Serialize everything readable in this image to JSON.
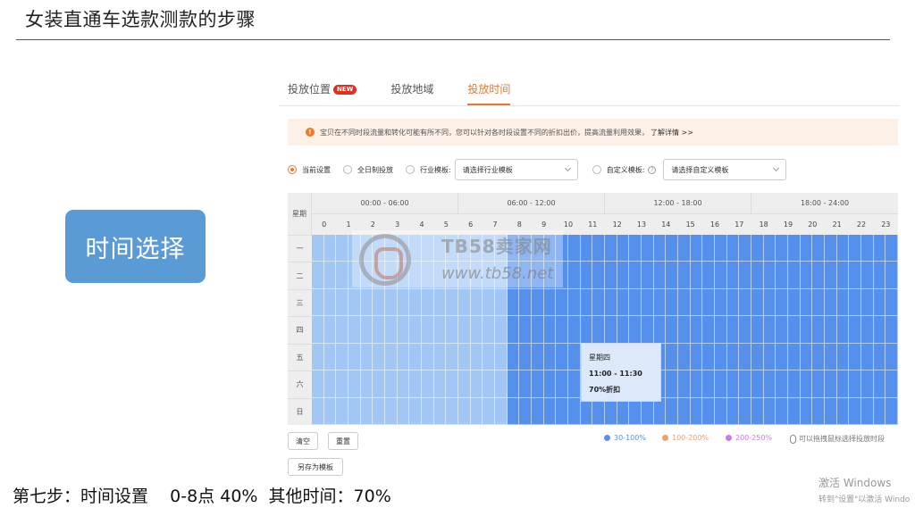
{
  "slide": {
    "title": "女装直通车选款测款的步骤",
    "step_box": "时间选择",
    "footer": "第七步：时间设置    0-8点 40%  其他时间：70%"
  },
  "tabs": [
    {
      "label": "投放位置",
      "badge": "NEW",
      "active": false
    },
    {
      "label": "投放地域",
      "active": false
    },
    {
      "label": "投放时间",
      "active": true
    }
  ],
  "notice": {
    "icon": "info-icon",
    "text": "宝贝在不同时段流量和转化可能有所不同，您可以针对各时段设置不同的折扣出价，提高流量利用效果，",
    "link": "了解详情 >>"
  },
  "options": {
    "current": "当前设置",
    "all_day": "全日制投放",
    "industry_label": "行业模板:",
    "industry_select": "请选择行业模板",
    "custom_label": "自定义模板:",
    "custom_select": "请选择自定义模板"
  },
  "schedule": {
    "week_header": "星期",
    "blocks": [
      "00:00 - 06:00",
      "06:00 - 12:00",
      "12:00 - 18:00",
      "18:00 - 24:00"
    ],
    "hours": [
      "0",
      "1",
      "2",
      "3",
      "4",
      "5",
      "6",
      "7",
      "8",
      "9",
      "10",
      "11",
      "12",
      "13",
      "14",
      "15",
      "16",
      "17",
      "18",
      "19",
      "20",
      "21",
      "22",
      "23"
    ],
    "days": [
      "一",
      "二",
      "三",
      "四",
      "五",
      "六",
      "日"
    ],
    "discounts": {
      "hours_0_to_7": 40,
      "hours_8_to_23": 70
    },
    "colors": {
      "low": "#a3c7f5",
      "high": "#5490ec"
    }
  },
  "tooltip": {
    "day": "星期四",
    "time": "11:00 - 11:30",
    "discount": "70%折扣"
  },
  "watermark": {
    "brand": "TB58卖家网",
    "url": "www.tb58.net"
  },
  "buttons": {
    "clear": "清空",
    "reset": "重置",
    "save_template": "另存为模板"
  },
  "legend": [
    {
      "label": "30-100%",
      "color": "#5b8def"
    },
    {
      "label": "100-200%",
      "color": "#f0a070"
    },
    {
      "label": "200-250%",
      "color": "#c77ae6"
    }
  ],
  "drag_hint": "可以拖拽鼠标选择投放时段",
  "windows_watermark": {
    "line1": "激活 Windows",
    "line2": "转到\"设置\"以激活 Windo"
  }
}
